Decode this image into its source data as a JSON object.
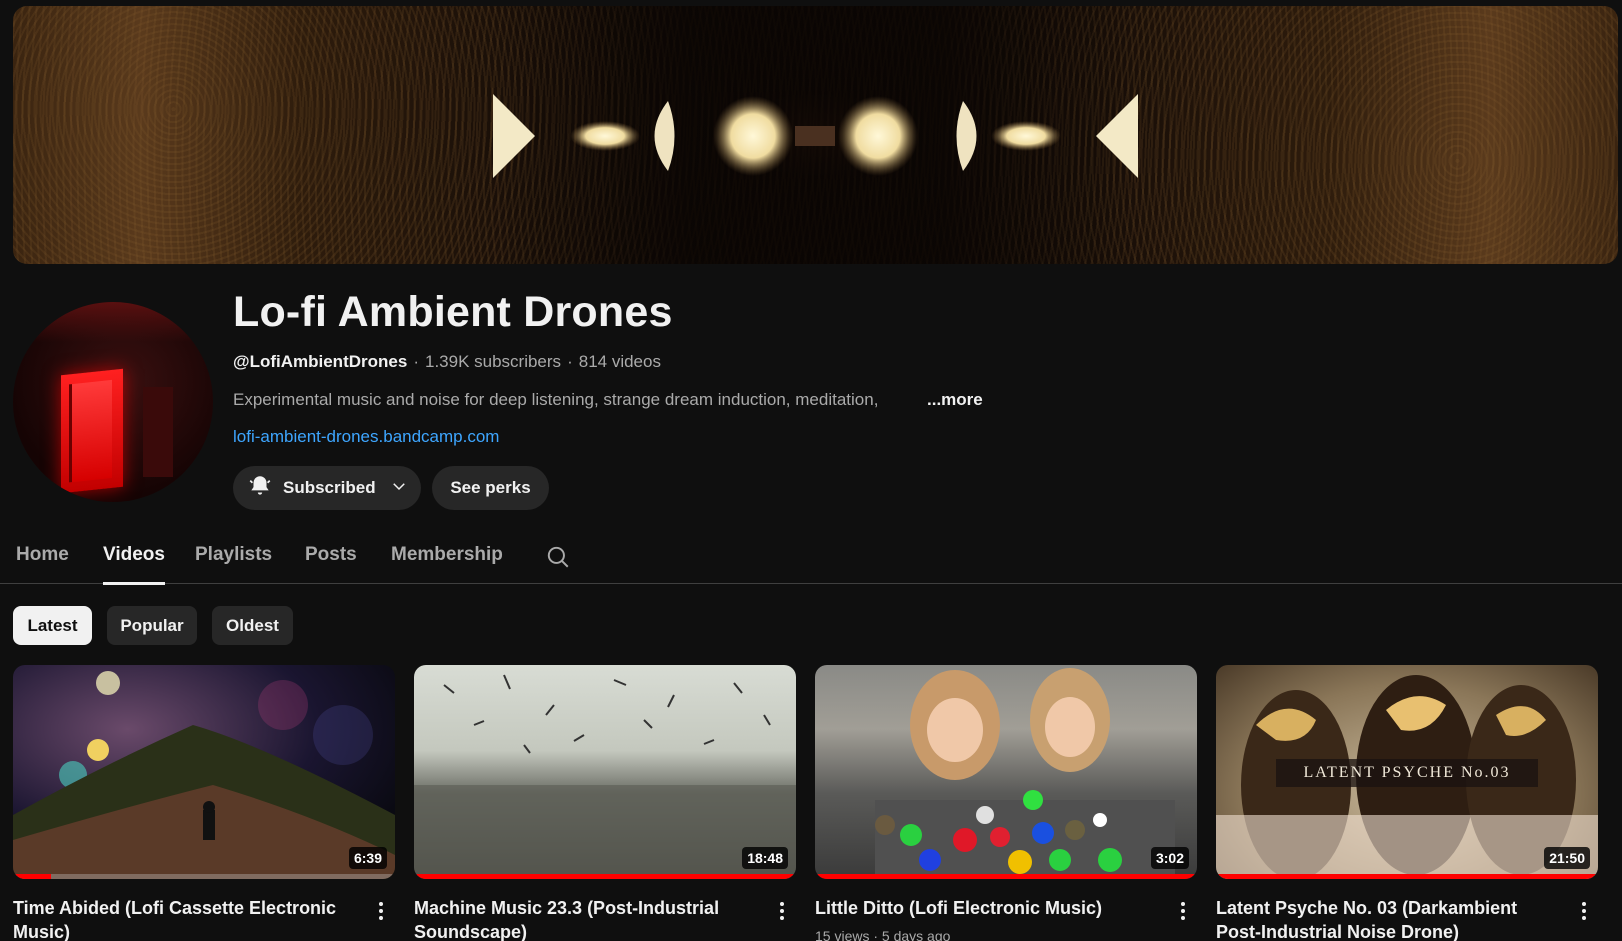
{
  "channel": {
    "title": "Lo-fi Ambient Drones",
    "handle": "@LofiAmbientDrones",
    "subscribers": "1.39K subscribers",
    "videos_count": "814 videos",
    "separator": "·",
    "description": "Experimental music and noise for deep listening, strange dream induction, meditation,",
    "more_label": "...more",
    "link": "lofi-ambient-drones.bandcamp.com"
  },
  "actions": {
    "subscribed_label": "Subscribed",
    "perks_label": "See perks"
  },
  "tabs": [
    {
      "label": "Home"
    },
    {
      "label": "Videos",
      "active": true
    },
    {
      "label": "Playlists"
    },
    {
      "label": "Posts"
    },
    {
      "label": "Membership"
    }
  ],
  "filters": [
    {
      "label": "Latest",
      "active": true
    },
    {
      "label": "Popular"
    },
    {
      "label": "Oldest"
    }
  ],
  "videos": [
    {
      "title": "Time Abided (Lofi Cassette Electronic Music)",
      "duration": "6:39",
      "watched_fraction": 0.1
    },
    {
      "title": "Machine Music 23.3 (Post-Industrial Soundscape)",
      "duration": "18:48",
      "watched_fraction": 1.0
    },
    {
      "title": "Little Ditto (Lofi Electronic Music)",
      "duration": "3:02",
      "sub": "15 views · 5 days ago",
      "watched_fraction": 1.0
    },
    {
      "title": "Latent Psyche No. 03 (Darkambient Post-Industrial Noise Drone)",
      "duration": "21:50",
      "thumb_text": "LATENT PSYCHE No.03",
      "watched_fraction": 1.0
    }
  ],
  "colors": {
    "background": "#0f0f0f",
    "link": "#3ea6ff",
    "progress": "#ff0000"
  }
}
